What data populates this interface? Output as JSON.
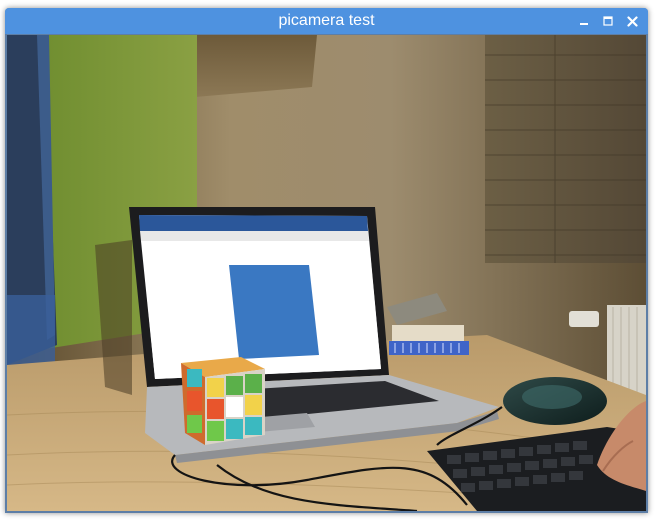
{
  "window": {
    "title": "picamera test",
    "controls": {
      "minimize_icon": "minimize-icon",
      "maximize_icon": "maximize-icon",
      "close_icon": "close-icon"
    }
  },
  "colors": {
    "titlebar": "#4e92e0",
    "title_text": "#ffffff",
    "window_frame": "#5d7ea6"
  },
  "camera_feed": {
    "description_icon": "camera-preview-image"
  }
}
